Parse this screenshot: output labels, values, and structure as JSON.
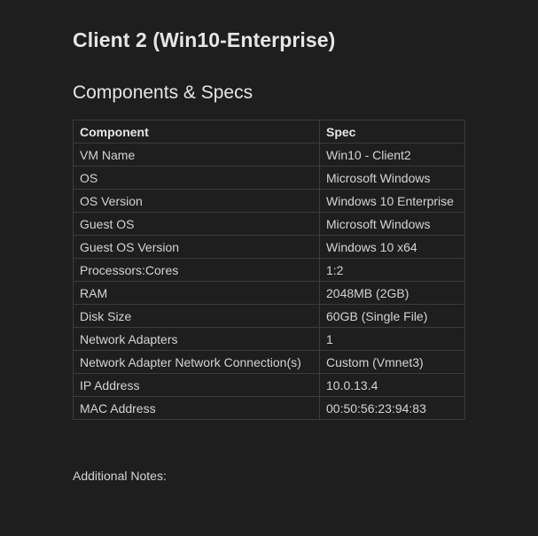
{
  "page": {
    "title": "Client 2 (Win10-Enterprise)",
    "section_title": "Components & Specs",
    "notes_label": "Additional Notes:"
  },
  "table": {
    "headers": [
      "Component",
      "Spec"
    ],
    "rows": [
      [
        "VM Name",
        "Win10 - Client2"
      ],
      [
        "OS",
        "Microsoft Windows"
      ],
      [
        "OS Version",
        "Windows 10 Enterprise"
      ],
      [
        "Guest OS",
        "Microsoft Windows"
      ],
      [
        "Guest OS Version",
        "Windows 10 x64"
      ],
      [
        "Processors:Cores",
        "1:2"
      ],
      [
        "RAM",
        "2048MB (2GB)"
      ],
      [
        "Disk Size",
        "60GB (Single File)"
      ],
      [
        "Network Adapters",
        "1"
      ],
      [
        "Network Adapter Network Connection(s)",
        "Custom (Vmnet3)"
      ],
      [
        "IP Address",
        "10.0.13.4"
      ],
      [
        "MAC Address",
        "00:50:56:23:94:83"
      ]
    ]
  },
  "colors": {
    "background": "#1e1e1e",
    "text": "#d4d4d4",
    "heading": "#e6e6e6",
    "table_border": "#3b3b3b"
  }
}
